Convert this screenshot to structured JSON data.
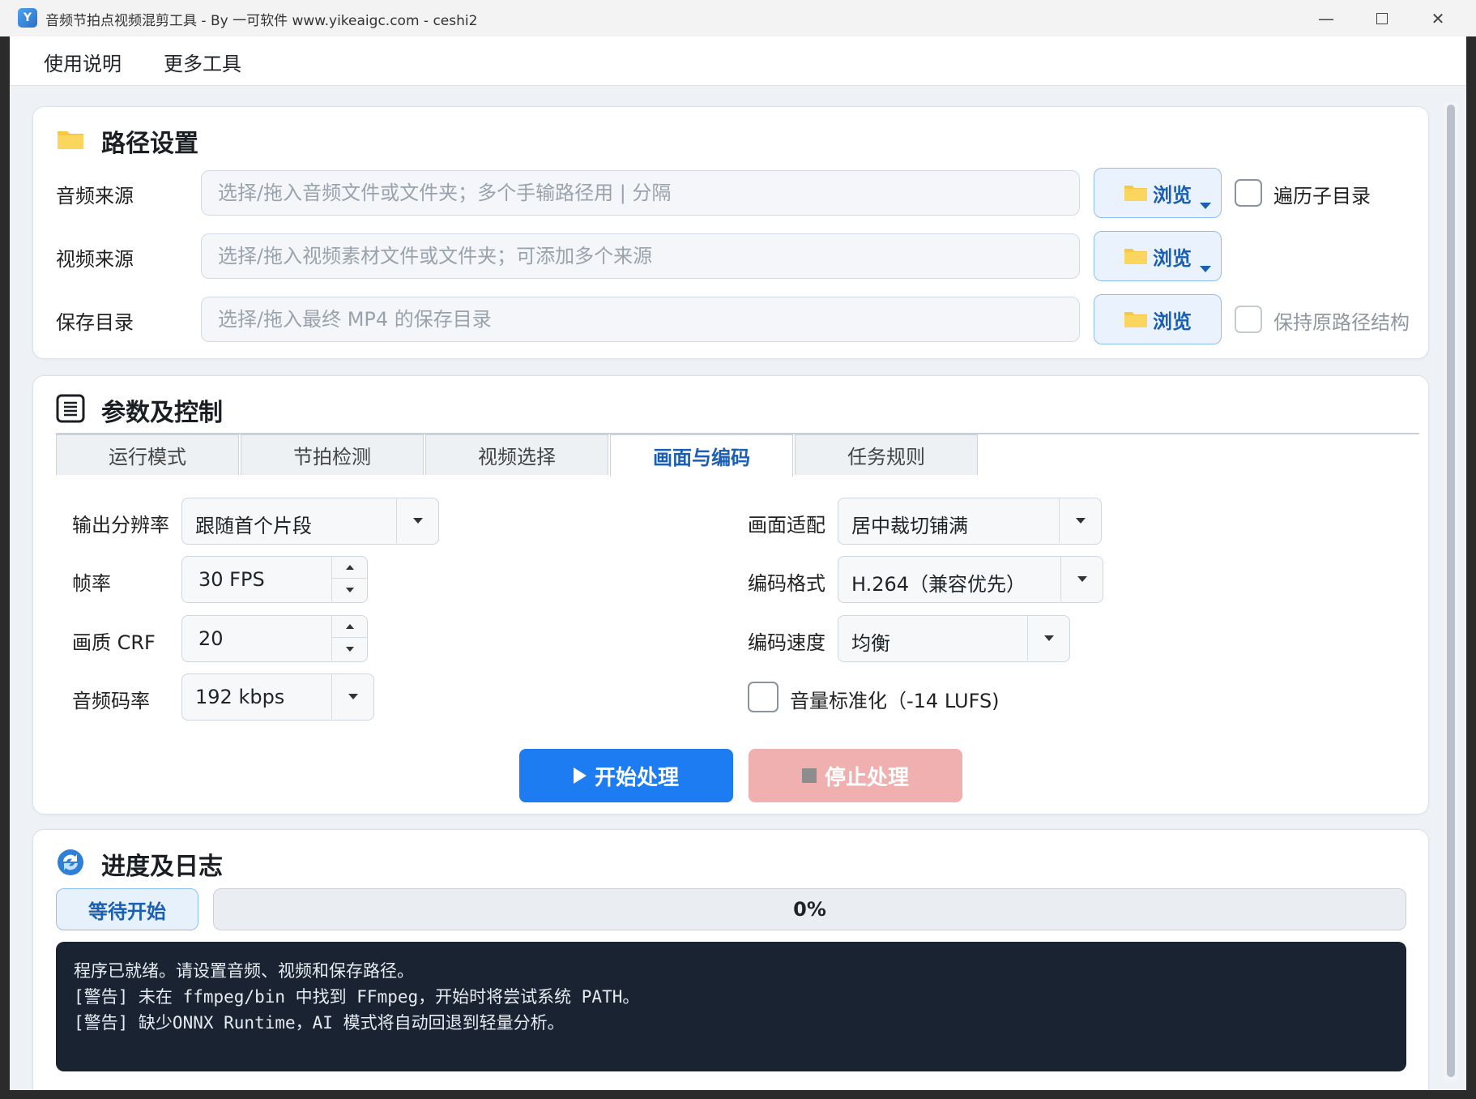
{
  "window": {
    "title": "音频节拍点视频混剪工具 - By 一可软件 www.yikeaigc.com - ceshi2",
    "app_icon_glyph": "Y"
  },
  "menu": {
    "items": [
      {
        "label": "使用说明"
      },
      {
        "label": "更多工具"
      }
    ]
  },
  "paths": {
    "title": "路径设置",
    "audio": {
      "label": "音频来源",
      "placeholder": "选择/拖入音频文件或文件夹；多个手输路径用 | 分隔",
      "value": ""
    },
    "video": {
      "label": "视频来源",
      "placeholder": "选择/拖入视频素材文件或文件夹；可添加多个来源",
      "value": ""
    },
    "save": {
      "label": "保存目录",
      "placeholder": "选择/拖入最终 MP4 的保存目录",
      "value": ""
    },
    "browse_label": "浏览",
    "recurse": {
      "label": "遍历子目录",
      "checked": false
    },
    "keep_structure": {
      "label": "保持原路径结构",
      "checked": false,
      "enabled": false
    }
  },
  "params": {
    "title": "参数及控制",
    "tabs": [
      {
        "label": "运行模式",
        "active": false
      },
      {
        "label": "节拍检测",
        "active": false
      },
      {
        "label": "视频选择",
        "active": false
      },
      {
        "label": "画面与编码",
        "active": true
      },
      {
        "label": "任务规则",
        "active": false
      }
    ],
    "resolution": {
      "label": "输出分辨率",
      "value": "跟随首个片段"
    },
    "fps": {
      "label": "帧率",
      "value": "30 FPS"
    },
    "crf": {
      "label": "画质 CRF",
      "value": "20"
    },
    "audio_bitrate": {
      "label": "音频码率",
      "value": "192 kbps"
    },
    "fit": {
      "label": "画面适配",
      "value": "居中裁切铺满"
    },
    "codec": {
      "label": "编码格式",
      "value": "H.264（兼容优先）"
    },
    "speed": {
      "label": "编码速度",
      "value": "均衡"
    },
    "normalize": {
      "label": "音量标准化（-14 LUFS)",
      "checked": false
    },
    "start_label": "开始处理",
    "stop_label": "停止处理"
  },
  "progress": {
    "title": "进度及日志",
    "status": "等待开始",
    "percent": 0,
    "percent_text": "0%",
    "log": [
      "程序已就绪。请设置音频、视频和保存路径。",
      "[警告] 未在 ffmpeg/bin 中找到 FFmpeg，开始时将尝试系统 PATH。",
      "[警告] 缺少ONNX Runtime，AI 模式将自动回退到轻量分析。"
    ]
  },
  "colors": {
    "accent": "#1d7cf2",
    "accent_text": "#1a5fb4",
    "stop_disabled": "#f0b0b0",
    "log_bg": "#1a2332"
  }
}
